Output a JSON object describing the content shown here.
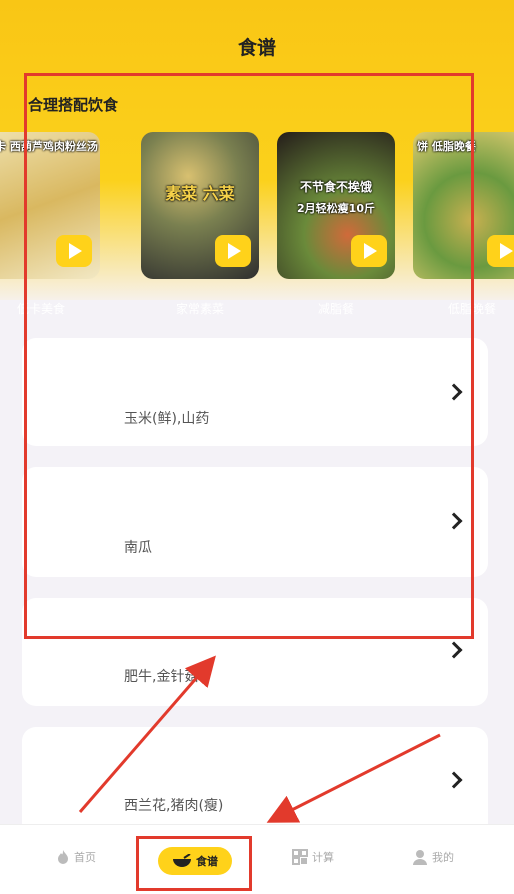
{
  "page": {
    "title": "食谱"
  },
  "section": {
    "title": "合理搭配饮食"
  },
  "videos": [
    {
      "caption_top": "低卡 西葫芦鸡肉粉丝汤",
      "caption_big": "",
      "caption_sub": "",
      "label": "低卡美食",
      "colors": [
        "#e8d8a0",
        "#c8a450",
        "#f0e6c0"
      ]
    },
    {
      "caption_top": "",
      "caption_big": "素菜 六菜",
      "caption_sub": "",
      "label": "家常素菜",
      "colors": [
        "#3a3a3a",
        "#6b7a4a",
        "#e0c05a"
      ]
    },
    {
      "caption_top": "",
      "caption_big": "不节食不挨饿",
      "caption_sub": "2月轻松瘦10斤",
      "label": "减脂餐",
      "colors": [
        "#2a2220",
        "#c24a2a",
        "#6a9a3a"
      ]
    },
    {
      "caption_top": "饼  低脂晚餐",
      "caption_big": "",
      "caption_sub": "",
      "label": "低脂晚餐",
      "colors": [
        "#5a8a3a",
        "#c8a84a",
        "#e8d070"
      ]
    }
  ],
  "recipes": [
    {
      "food": "玉米(鲜),山药"
    },
    {
      "food": "南瓜"
    },
    {
      "food": "肥牛,金针菇"
    },
    {
      "food": "西兰花,猪肉(瘦)"
    }
  ],
  "tabs": [
    {
      "label": "首页",
      "icon": "flame-icon"
    },
    {
      "label": "食谱",
      "icon": "bowl-icon"
    },
    {
      "label": "计算",
      "icon": "grid-icon"
    },
    {
      "label": "我的",
      "icon": "user-icon"
    }
  ],
  "colors": {
    "accent": "#ffd21a",
    "highlight": "#e23a2c"
  }
}
